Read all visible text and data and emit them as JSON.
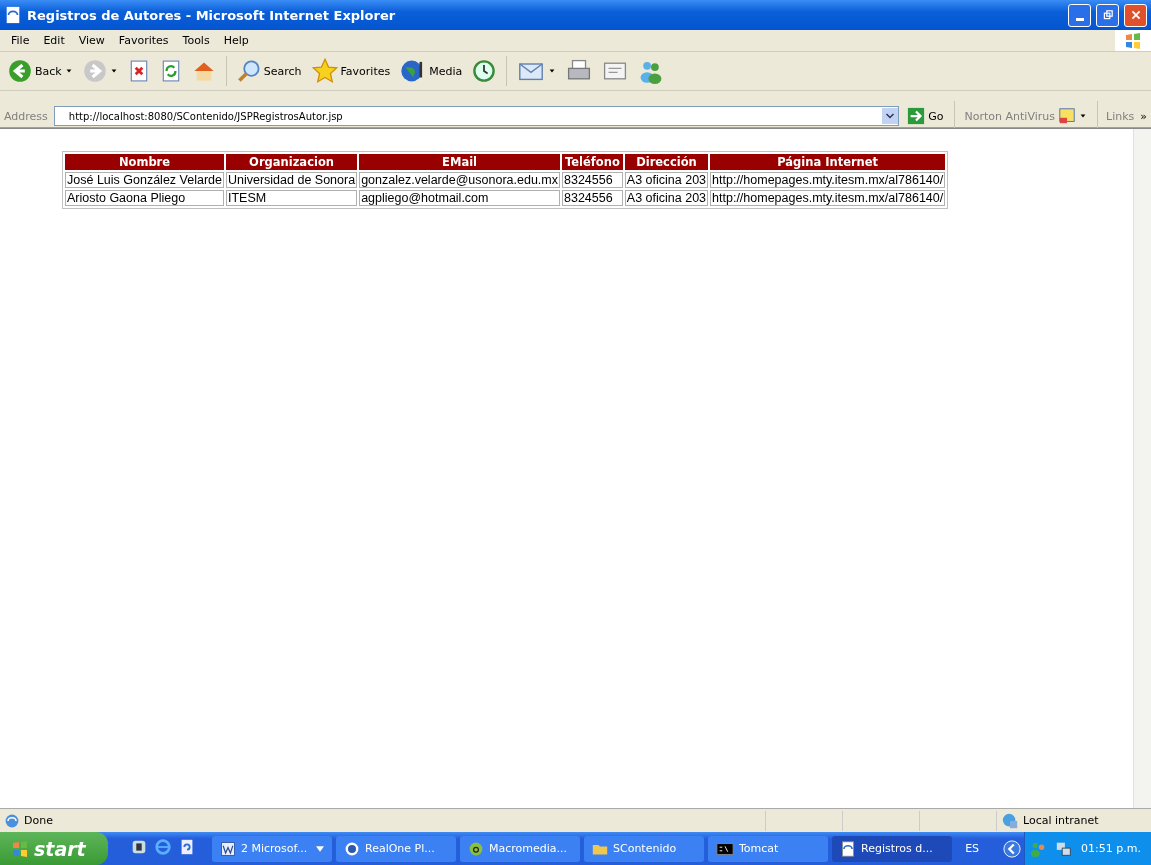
{
  "window": {
    "title": "Registros de Autores - Microsoft Internet Explorer"
  },
  "menu": [
    "File",
    "Edit",
    "View",
    "Favorites",
    "Tools",
    "Help"
  ],
  "toolbar": [
    {
      "kind": "back",
      "label": "Back"
    },
    {
      "kind": "forward"
    },
    {
      "kind": "stop"
    },
    {
      "kind": "refresh"
    },
    {
      "kind": "home"
    },
    {
      "kind": "search",
      "label": "Search"
    },
    {
      "kind": "favorites",
      "label": "Favorites"
    },
    {
      "kind": "media",
      "label": "Media"
    },
    {
      "kind": "history"
    },
    {
      "kind": "mail"
    },
    {
      "kind": "print"
    },
    {
      "kind": "edit"
    },
    {
      "kind": "messenger"
    }
  ],
  "address": {
    "label": "Address",
    "value": "http://localhost:8080/SContenido/JSPRegistrosAutor.jsp",
    "go": "Go",
    "norton": "Norton AntiVirus",
    "links": "Links",
    "more": "»"
  },
  "table": {
    "columns": [
      "Nombre",
      "Organizacion",
      "EMail",
      "Teléfono",
      "Dirección",
      "Página Internet"
    ],
    "rows": [
      [
        "José Luis González Velarde",
        "Universidad de Sonora",
        "gonzalez.velarde@usonora.edu.mx",
        "8324556",
        "A3 oficina 203",
        "http://homepages.mty.itesm.mx/al786140/"
      ],
      [
        "Ariosto Gaona Pliego",
        "ITESM",
        "agpliego@hotmail.com",
        "8324556",
        "A3 oficina 203",
        "http://homepages.mty.itesm.mx/al786140/"
      ]
    ]
  },
  "status_bar": {
    "text": "Done",
    "zone": "Local intranet"
  },
  "taskbar": {
    "start": "start",
    "quick_launch": [
      {
        "kind": "app"
      },
      {
        "kind": "browser"
      },
      {
        "kind": "refresh"
      }
    ],
    "buttons": [
      {
        "kind": "word",
        "label": "2 Microsof...",
        "selected": false,
        "menu": true
      },
      {
        "kind": "player",
        "label": "RealOne Pl...",
        "selected": false,
        "menu": false
      },
      {
        "kind": "macromedia",
        "label": "Macromedia...",
        "selected": false,
        "menu": false
      },
      {
        "kind": "folder",
        "label": "SContenido",
        "selected": false,
        "menu": false
      },
      {
        "kind": "console",
        "label": "Tomcat",
        "selected": false,
        "menu": false
      },
      {
        "kind": "browser",
        "label": "Registros d...",
        "selected": true,
        "menu": false
      }
    ],
    "language": "ES",
    "clock": "01:51 p.m."
  }
}
